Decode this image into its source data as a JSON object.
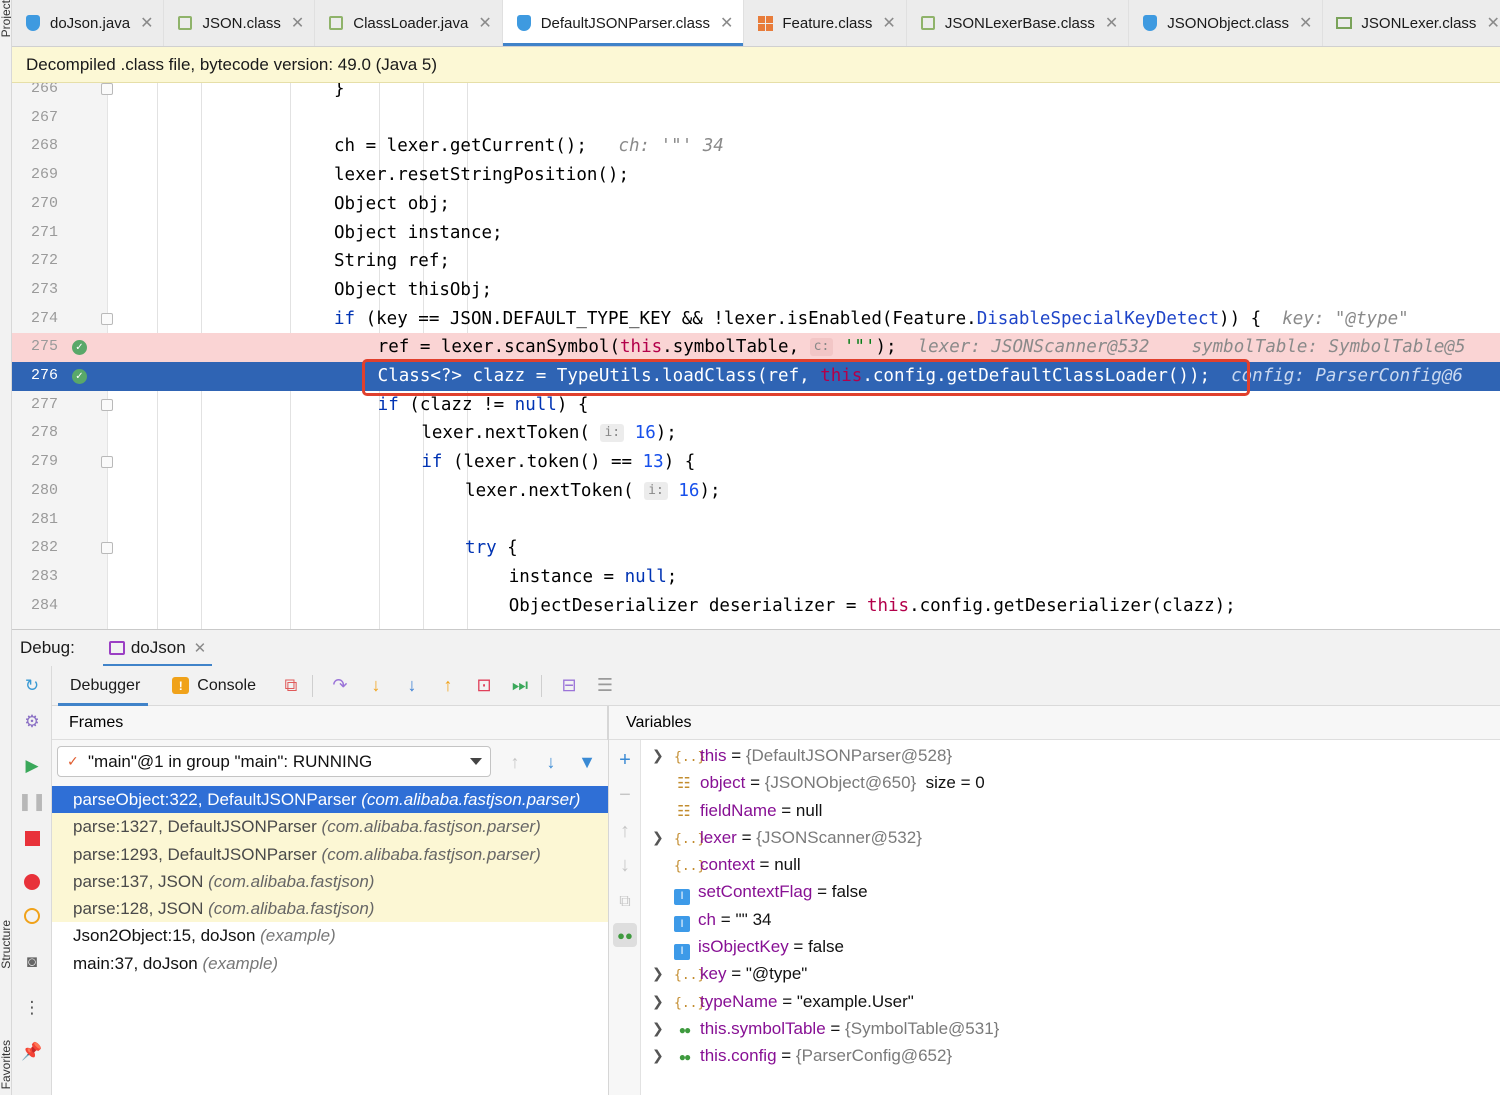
{
  "side_labels": [
    "Project",
    "Structure",
    "Favorites"
  ],
  "tabs": [
    {
      "label": "doJson.java",
      "icon": "java-class-icon",
      "active": false
    },
    {
      "label": "JSON.class",
      "icon": "class-file-icon",
      "active": false
    },
    {
      "label": "ClassLoader.java",
      "icon": "class-file-icon",
      "active": false
    },
    {
      "label": "DefaultJSONParser.class",
      "icon": "java-class-icon",
      "active": true
    },
    {
      "label": "Feature.class",
      "icon": "enum-icon",
      "active": false
    },
    {
      "label": "JSONLexerBase.class",
      "icon": "class-file-icon",
      "active": false
    },
    {
      "label": "JSONObject.class",
      "icon": "java-class-icon",
      "active": false
    },
    {
      "label": "JSONLexer.class",
      "icon": "interface-icon",
      "active": false
    }
  ],
  "notice": "Decompiled .class file, bytecode version: 49.0 (Java 5)",
  "editor": {
    "lines": [
      {
        "n": "266",
        "code": "                            }"
      },
      {
        "n": "267",
        "code": ""
      },
      {
        "n": "268",
        "code": "                            ch = lexer.getCurrent();   ",
        "hint": "ch: '\"' 34"
      },
      {
        "n": "269",
        "code": "                            lexer.resetStringPosition();"
      },
      {
        "n": "270",
        "code": "                            Object obj;"
      },
      {
        "n": "271",
        "code": "                            Object instance;"
      },
      {
        "n": "272",
        "code": "                            String ref;"
      },
      {
        "n": "273",
        "code": "                            Object thisObj;"
      },
      {
        "n": "274",
        "code": "                            if (key == JSON.DEFAULT_TYPE_KEY && !lexer.isEnabled(Feature.DisableSpecialKeyDetect)) {  ",
        "hint": "key: \"@type\""
      },
      {
        "n": "275",
        "code": "                                ref = lexer.scanSymbol(this.symbolTable, ",
        "param": "c:",
        "code2": " '\"');  ",
        "hint": "lexer: JSONScanner@532    symbolTable: SymbolTable@5"
      },
      {
        "n": "276",
        "code": "                                Class<?> clazz = TypeUtils.loadClass(ref, this.config.getDefaultClassLoader());  ",
        "hint": "config: ParserConfig@6"
      },
      {
        "n": "277",
        "code": "                                if (clazz != null) {"
      },
      {
        "n": "278",
        "code": "                                    lexer.nextToken( ",
        "param": "i:",
        "code2": " 16);"
      },
      {
        "n": "279",
        "code": "                                    if (lexer.token() == 13) {"
      },
      {
        "n": "280",
        "code": "                                        lexer.nextToken( ",
        "param": "i:",
        "code2": " 16);"
      },
      {
        "n": "281",
        "code": ""
      },
      {
        "n": "282",
        "code": "                                        try {"
      },
      {
        "n": "283",
        "code": "                                            instance = null;"
      },
      {
        "n": "284",
        "code": "                                            ObjectDeserializer deserializer = this.config.getDeserializer(clazz);"
      }
    ]
  },
  "debug": {
    "label": "Debug:",
    "session": "doJson",
    "tabs": [
      "Debugger",
      "Console"
    ],
    "frames_title": "Frames",
    "variables_title": "Variables",
    "thread": "\"main\"@1 in group \"main\": RUNNING",
    "frames": [
      {
        "method": "parseObject:322, DefaultJSONParser",
        "pkg": "(com.alibaba.fastjson.parser)",
        "kind": "selected"
      },
      {
        "method": "parse:1327, DefaultJSONParser",
        "pkg": "(com.alibaba.fastjson.parser)",
        "kind": "lib"
      },
      {
        "method": "parse:1293, DefaultJSONParser",
        "pkg": "(com.alibaba.fastjson.parser)",
        "kind": "lib"
      },
      {
        "method": "parse:137, JSON",
        "pkg": "(com.alibaba.fastjson)",
        "kind": "lib"
      },
      {
        "method": "parse:128, JSON",
        "pkg": "(com.alibaba.fastjson)",
        "kind": "lib"
      },
      {
        "method": "Json2Object:15, doJson",
        "pkg": "(example)",
        "kind": "user"
      },
      {
        "method": "main:37, doJson",
        "pkg": "(example)",
        "kind": "user"
      }
    ],
    "variables": [
      {
        "expand": true,
        "icon": "obj",
        "name": "this",
        "value": "{DefaultJSONParser@528}",
        "gray": true
      },
      {
        "expand": false,
        "icon": "arr",
        "name": "object",
        "value": "{JSONObject@650}",
        "gray": true,
        "extra": "  size = 0"
      },
      {
        "expand": false,
        "icon": "arr",
        "name": "fieldName",
        "value": "null",
        "gray": false
      },
      {
        "expand": true,
        "icon": "obj",
        "name": "lexer",
        "value": "{JSONScanner@532}",
        "gray": true
      },
      {
        "expand": false,
        "icon": "obj",
        "name": "context",
        "value": "null",
        "gray": false
      },
      {
        "expand": false,
        "icon": "prim",
        "name": "setContextFlag",
        "value": "false",
        "gray": false
      },
      {
        "expand": false,
        "icon": "prim",
        "name": "ch",
        "value": "'\"' 34",
        "gray": false
      },
      {
        "expand": false,
        "icon": "prim",
        "name": "isObjectKey",
        "value": "false",
        "gray": false
      },
      {
        "expand": true,
        "icon": "obj",
        "name": "key",
        "value": "\"@type\"",
        "gray": false
      },
      {
        "expand": true,
        "icon": "obj",
        "name": "typeName",
        "value": "\"example.User\"",
        "gray": false
      },
      {
        "expand": true,
        "icon": "watch",
        "name": "this.symbolTable",
        "value": "{SymbolTable@531}",
        "gray": true
      },
      {
        "expand": true,
        "icon": "watch",
        "name": "this.config",
        "value": "{ParserConfig@652}",
        "gray": true
      }
    ]
  }
}
